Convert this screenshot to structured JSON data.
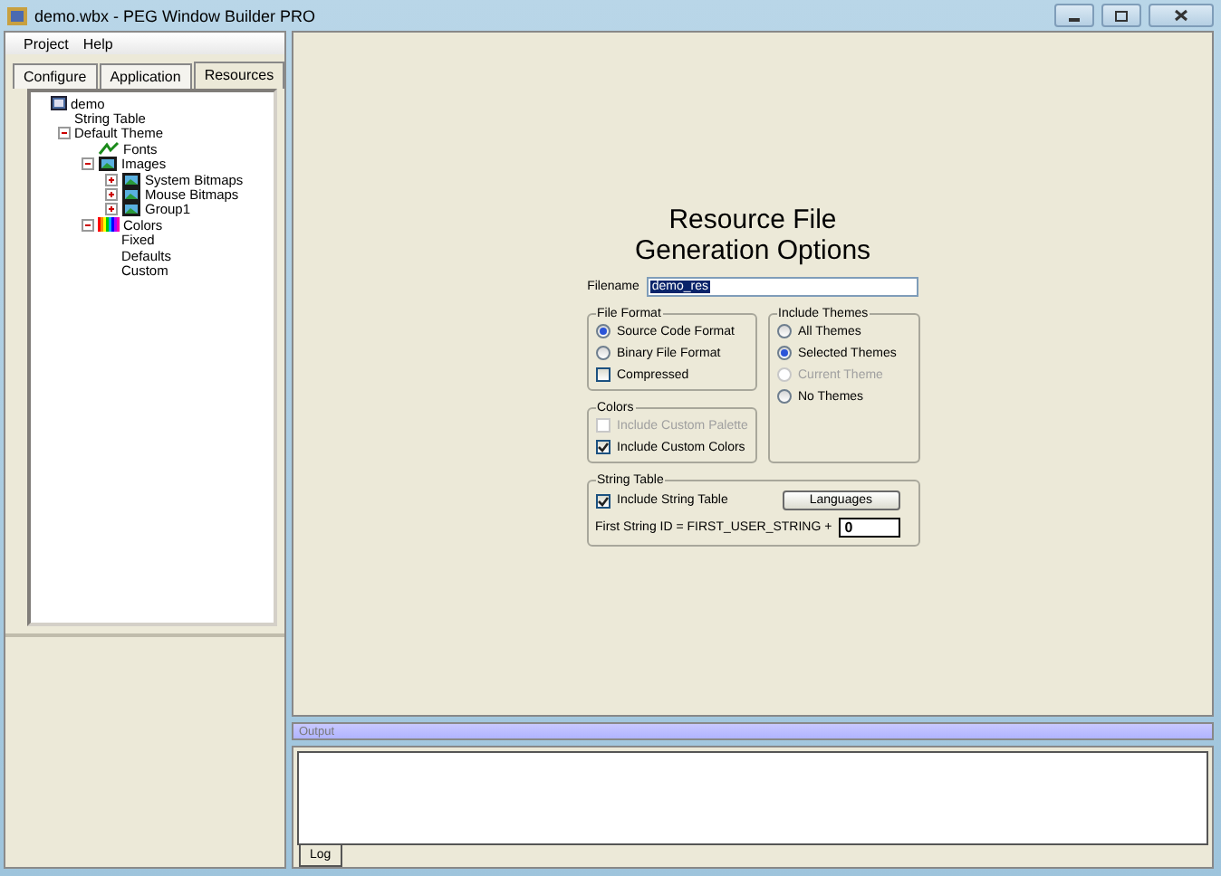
{
  "window": {
    "title": "demo.wbx - PEG Window Builder PRO"
  },
  "menu": [
    "Project",
    "Help"
  ],
  "tabs": [
    {
      "label": "Configure",
      "selected": false
    },
    {
      "label": "Application",
      "selected": false
    },
    {
      "label": "Resources",
      "selected": true
    }
  ],
  "tree": [
    {
      "label": "demo",
      "kind": "app",
      "children": [
        {
          "label": "String Table"
        },
        {
          "label": "Default Theme",
          "expanded": true,
          "children": [
            {
              "label": "Fonts",
              "kind": "font"
            },
            {
              "label": "Images",
              "kind": "image",
              "expanded": true,
              "children": [
                {
                  "label": "System Bitmaps",
                  "kind": "image",
                  "expanded": false
                },
                {
                  "label": "Mouse Bitmaps",
                  "kind": "image",
                  "expanded": false
                },
                {
                  "label": "Group1",
                  "kind": "image",
                  "expanded": false
                }
              ]
            },
            {
              "label": "Colors",
              "kind": "colors",
              "expanded": true,
              "children": [
                {
                  "label": "Fixed"
                },
                {
                  "label": "Defaults"
                },
                {
                  "label": "Custom"
                }
              ]
            }
          ]
        }
      ]
    }
  ],
  "form": {
    "title_lines": [
      "Resource File",
      "Generation Options"
    ],
    "filename": {
      "label": "Filename",
      "value": "demo_res"
    },
    "file_format": {
      "title": "File Format",
      "options": [
        {
          "label": "Source Code Format",
          "selected": true
        },
        {
          "label": "Binary File Format",
          "selected": false
        }
      ],
      "compressed": {
        "label": "Compressed",
        "checked": false
      }
    },
    "include_themes": {
      "title": "Include Themes",
      "options": [
        {
          "label": "All Themes",
          "selected": false,
          "disabled": false
        },
        {
          "label": "Selected Themes",
          "selected": true,
          "disabled": false
        },
        {
          "label": "Current Theme",
          "selected": false,
          "disabled": true
        },
        {
          "label": "No Themes",
          "selected": false,
          "disabled": false
        }
      ]
    },
    "colors": {
      "title": "Colors",
      "options": [
        {
          "label": "Include Custom Palette",
          "checked": false,
          "disabled": true
        },
        {
          "label": "Include Custom Colors",
          "checked": true,
          "disabled": false
        }
      ]
    },
    "string_table": {
      "title": "String Table",
      "include": {
        "label": "Include String Table",
        "checked": true
      },
      "button": "Languages",
      "id_label": "First String ID = FIRST_USER_STRING +",
      "id_value": "0"
    }
  },
  "output": {
    "title": "Output",
    "tabs": [
      {
        "label": "Log",
        "selected": true
      }
    ]
  }
}
